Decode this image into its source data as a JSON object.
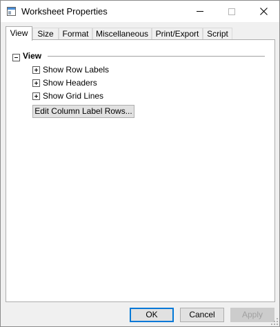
{
  "window": {
    "title": "Worksheet Properties"
  },
  "tabs": [
    {
      "label": "View",
      "selected": true
    },
    {
      "label": "Size",
      "selected": false
    },
    {
      "label": "Format",
      "selected": false
    },
    {
      "label": "Miscellaneous",
      "selected": false
    },
    {
      "label": "Print/Export",
      "selected": false
    },
    {
      "label": "Script",
      "selected": false
    }
  ],
  "panel": {
    "section_title": "View",
    "section_expanded": true,
    "rows": [
      {
        "label": "Show Row Labels",
        "expanded": false
      },
      {
        "label": "Show Headers",
        "expanded": false
      },
      {
        "label": "Show Grid Lines",
        "expanded": false
      }
    ],
    "edit_button_label": "Edit Column Label Rows..."
  },
  "footer": {
    "ok_label": "OK",
    "cancel_label": "Cancel",
    "apply_label": "Apply",
    "apply_enabled": false
  },
  "colors": {
    "accent": "#0078d7",
    "dialog_bg": "#f0f0f0",
    "panel_bg": "#ffffff",
    "disabled_text": "#a0a0a0"
  }
}
